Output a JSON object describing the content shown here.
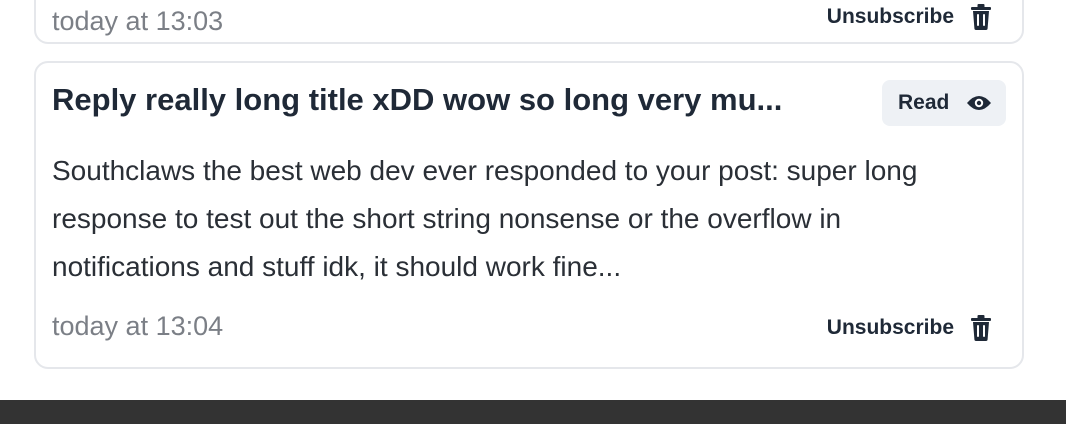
{
  "notifications": [
    {
      "timestamp": "today at 13:03",
      "unsubscribe_label": "Unsubscribe"
    },
    {
      "title": "Reply really long title xDD wow so long very mu...",
      "read_label": "Read",
      "body": "Southclaws the best web dev ever responded to your post: super long response to test out the short string nonsense or the overflow in notifications and stuff idk, it should work fine...",
      "timestamp": "today at 13:04",
      "unsubscribe_label": "Unsubscribe"
    }
  ],
  "icons": {
    "read": "eye-icon",
    "unsubscribe": "trash-icon"
  },
  "colors": {
    "border": "#e5e7eb",
    "read_button_bg": "#eef1f5",
    "timestamp": "#7b7f86",
    "footer": "#333333"
  }
}
